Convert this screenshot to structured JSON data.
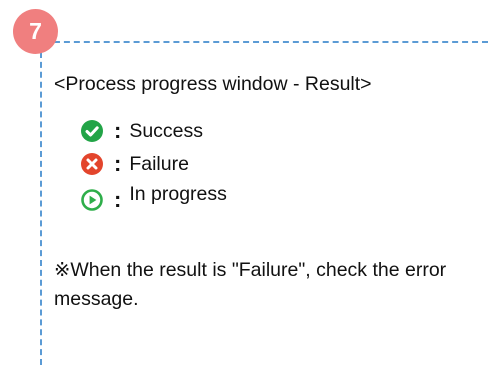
{
  "step": {
    "number": "7",
    "badge_color": "#f07f7f"
  },
  "frame": {
    "border_color": "#5b9bd5"
  },
  "heading": "<Process progress window - Result>",
  "legend": [
    {
      "icon": "success-check-icon",
      "color": "#22a447",
      "separator": ":",
      "label": "Success"
    },
    {
      "icon": "failure-x-icon",
      "color": "#e3452c",
      "separator": ":",
      "label": "Failure"
    },
    {
      "icon": "in-progress-play-icon",
      "color": "#2eae4a",
      "separator": ":",
      "label": "In progress"
    }
  ],
  "note": "※When the result is \"Failure\", check the error message."
}
